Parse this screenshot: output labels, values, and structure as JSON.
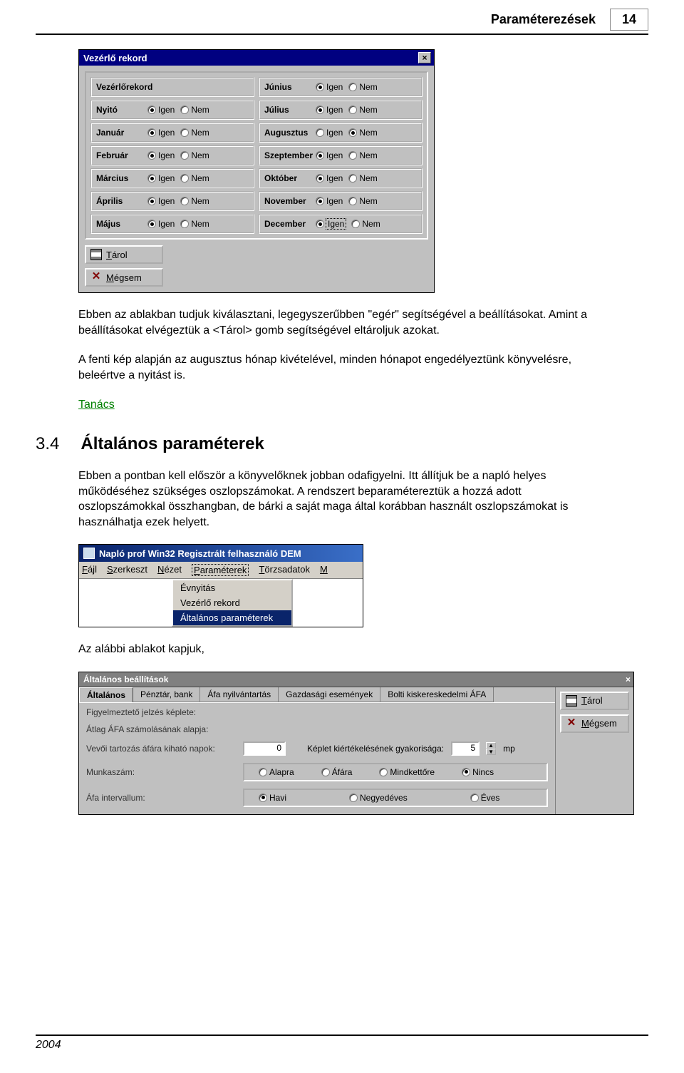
{
  "header": {
    "title": "Paraméterezések",
    "page_number": "14"
  },
  "footer": {
    "year": "2004"
  },
  "dialog1": {
    "title": "Vezérlő rekord",
    "first_label": "Vezérlőrekord",
    "yes": "Igen",
    "no": "Nem",
    "left_rows": [
      {
        "label": "Nyitó",
        "sel": "Igen"
      },
      {
        "label": "Január",
        "sel": "Igen"
      },
      {
        "label": "Február",
        "sel": "Igen"
      },
      {
        "label": "Március",
        "sel": "Igen"
      },
      {
        "label": "Április",
        "sel": "Igen"
      },
      {
        "label": "Május",
        "sel": "Igen"
      }
    ],
    "right_rows": [
      {
        "label": "Június",
        "sel": "Igen"
      },
      {
        "label": "Július",
        "sel": "Igen"
      },
      {
        "label": "Augusztus",
        "sel": "Nem"
      },
      {
        "label": "Szeptember",
        "sel": "Igen"
      },
      {
        "label": "Október",
        "sel": "Igen"
      },
      {
        "label": "November",
        "sel": "Igen"
      },
      {
        "label": "December",
        "sel": "Igen",
        "boxed": true
      }
    ],
    "save_btn": "Tárol",
    "cancel_btn": "Mégsem"
  },
  "para1": "Ebben az ablakban tudjuk kiválasztani, legegyszerűbben \"egér\" segítségével a beállításokat. Amint a beállításokat elvégeztük a <Tárol> gomb segítségével eltároljuk azokat.",
  "para2": "A fenti kép alapján az augusztus hónap kivételével, minden hónapot engedélyeztünk könyvelésre, beleértve a nyitást is.",
  "tip_link": "Tanács",
  "section": {
    "num": "3.4",
    "title": "Általános paraméterek"
  },
  "para3": "Ebben a pontban kell először a könyvelőknek jobban odafigyelni. Itt állítjuk be a napló helyes működéséhez szükséges oszlopszámokat. A rendszert beparamétereztük a hozzá adott oszlopszámokkal összhangban, de bárki a saját maga által korábban használt oszlopszámokat is használhatja ezek helyett.",
  "menu": {
    "title": "Napló prof Win32 Regisztrált felhasználó  DEM",
    "items": [
      "Fájl",
      "Szerkeszt",
      "Nézet",
      "Paraméterek",
      "Törzsadatok",
      "M"
    ],
    "dropdown": [
      "Évnyitás",
      "Vezérlő rekord",
      "Általános paraméterek"
    ],
    "dropdown_selected_index": 2
  },
  "para4": "Az alábbi ablakot kapjuk,",
  "dialog2": {
    "title": "Általános beállítások",
    "tabs": [
      "Általános",
      "Pénztár, bank",
      "Áfa nyilvántartás",
      "Gazdasági események",
      "Bolti kiskereskedelmi ÁFA"
    ],
    "active_tab_index": 0,
    "fields": {
      "warn_formula": "Figyelmeztető jelzés képlete:",
      "avg_vat_base": "Átlag ÁFA számolásának alapja:",
      "debt_days": "Vevői tartozás áfára kiható napok:",
      "debt_days_value": "0",
      "eval_freq": "Képlet kiértékelésének gyakorisága:",
      "eval_freq_value": "5",
      "eval_freq_unit": "mp",
      "work_number": "Munkaszám:",
      "work_number_options": [
        "Alapra",
        "Áfára",
        "Mindkettőre",
        "Nincs"
      ],
      "work_number_selected": "Nincs",
      "vat_interval": "Áfa intervallum:",
      "vat_interval_options": [
        "Havi",
        "Negyedéves",
        "Éves"
      ],
      "vat_interval_selected": "Havi"
    },
    "save_btn": "Tárol",
    "cancel_btn": "Mégsem"
  }
}
